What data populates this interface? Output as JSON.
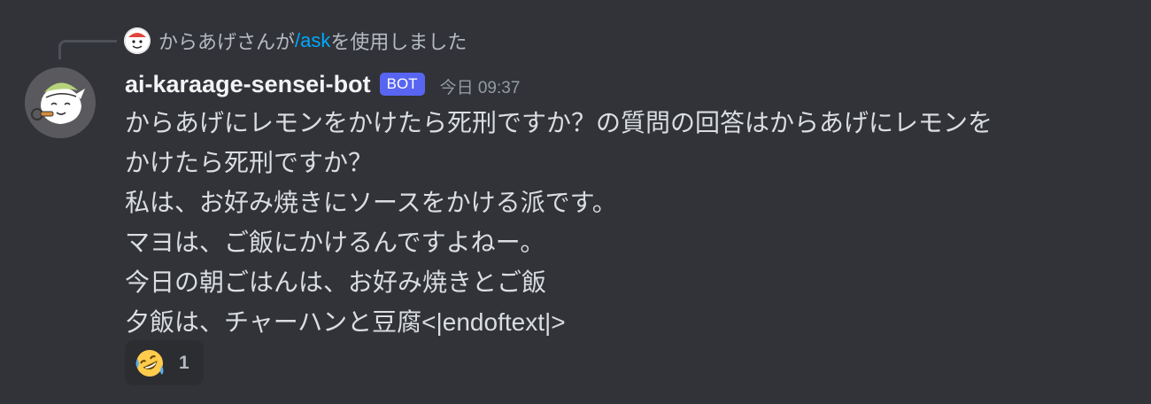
{
  "reply": {
    "user": "からあげさん",
    "pre": "が",
    "command": "/ask",
    "post": "を使用しました"
  },
  "message": {
    "username": "ai-karaage-sensei-bot",
    "tag": "BOT",
    "timestamp": "今日 09:37",
    "lines": [
      "からあげにレモンをかけたら死刑ですか？の質問の回答はからあげにレモンを",
      "かけたら死刑ですか？",
      "私は、お好み焼きにソースをかける派です。",
      "マヨは、ご飯にかけるんですよねー。",
      "今日の朝ごはんは、お好み焼きとご飯",
      "夕飯は、チャーハンと豆腐<|endoftext|>"
    ]
  },
  "reaction": {
    "emoji": "rolling-on-floor-laughing-emoji",
    "count": "1"
  },
  "colors": {
    "background": "#313338",
    "bot_tag": "#5865f2",
    "command_link": "#00a8fc",
    "reaction_bg": "#2b2d31"
  }
}
